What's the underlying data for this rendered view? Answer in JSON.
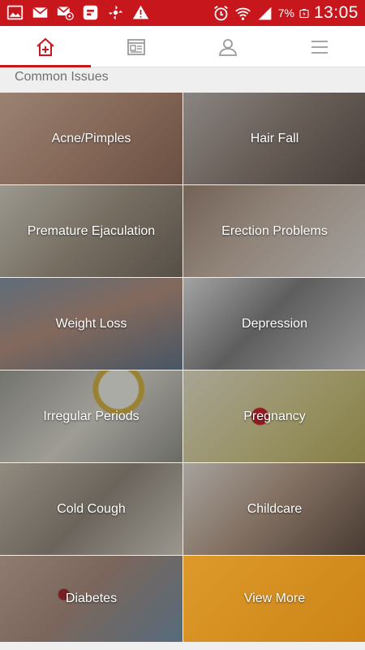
{
  "status_bar": {
    "left_icons": [
      "gallery-icon",
      "mail-icon",
      "mail-at-icon",
      "app-icon",
      "sync-icon",
      "warning-icon"
    ],
    "battery_percent": "7%",
    "time": "13:05"
  },
  "nav": {
    "tabs": [
      {
        "name": "tab-home",
        "icon": "home-plus-icon",
        "active": true
      },
      {
        "name": "tab-articles",
        "icon": "article-icon",
        "active": false
      },
      {
        "name": "tab-profile",
        "icon": "user-icon",
        "active": false
      },
      {
        "name": "tab-menu",
        "icon": "menu-icon",
        "active": false
      }
    ]
  },
  "section": {
    "title": "Common Issues"
  },
  "issues": [
    {
      "label": "Acne/Pimples",
      "color": "#b9917c"
    },
    {
      "label": "Hair Fall",
      "color": "#8e8580"
    },
    {
      "label": "Premature Ejaculation",
      "color": "#8f8a7e"
    },
    {
      "label": "Erection Problems",
      "color": "#8e8077"
    },
    {
      "label": "Weight Loss",
      "color": "#6a7f95"
    },
    {
      "label": "Depression",
      "color": "#8d8d8d"
    },
    {
      "label": "Irregular Periods",
      "color": "#b5b7a9"
    },
    {
      "label": "Pregnancy",
      "color": "#b9b376"
    },
    {
      "label": "Cold Cough",
      "color": "#a09a8c"
    },
    {
      "label": "Childcare",
      "color": "#a49888"
    },
    {
      "label": "Diabetes",
      "color": "#9a8c88"
    },
    {
      "label": "View More",
      "color": "#d58e1c"
    }
  ],
  "colors": {
    "brand_red": "#c8161d",
    "view_more_orange": "#d58e1c"
  }
}
